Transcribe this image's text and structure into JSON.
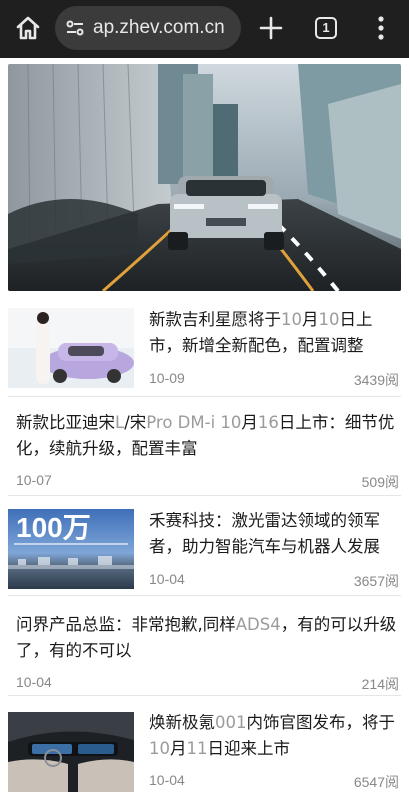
{
  "browser": {
    "url": "ap.zhev.com.cn",
    "tab_count": "1"
  },
  "articles": [
    {
      "title_parts": [
        "新款吉利星愿将于",
        "10",
        "月",
        "10",
        "日上市，新增全新配色，配置调整"
      ],
      "date": "10-09",
      "views": "3439阅",
      "has_thumb": true
    },
    {
      "title_parts": [
        "新款比亚迪宋",
        "L",
        "/宋",
        "Pro DM-i 10",
        "月",
        "16",
        "日上市：细节优化，续航升级，配置丰富"
      ],
      "date": "10-07",
      "views": "509阅",
      "has_thumb": false
    },
    {
      "title_parts": [
        "禾赛科技：激光雷达领域的领军者，助力智能汽车与机器人发展"
      ],
      "date": "10-04",
      "views": "3657阅",
      "has_thumb": true,
      "thumb_text": "100万"
    },
    {
      "title_parts": [
        "问界产品总监：非常抱歉,同样",
        "ADS4",
        "，有的可以升级了，有的不可以"
      ],
      "date": "10-04",
      "views": "214阅",
      "has_thumb": false
    },
    {
      "title_parts": [
        "焕新极氪",
        "001",
        "内饰官图发布，将于",
        "10",
        "月",
        "11",
        "日迎来上市"
      ],
      "date": "10-04",
      "views": "6547阅",
      "has_thumb": true
    }
  ],
  "colors": {
    "chrome_bg": "#1f1f1f",
    "url_pill": "#3b3b3b",
    "text": "#1a1a1a",
    "muted": "#888888",
    "latin_highlight": "#9b9b9b"
  }
}
